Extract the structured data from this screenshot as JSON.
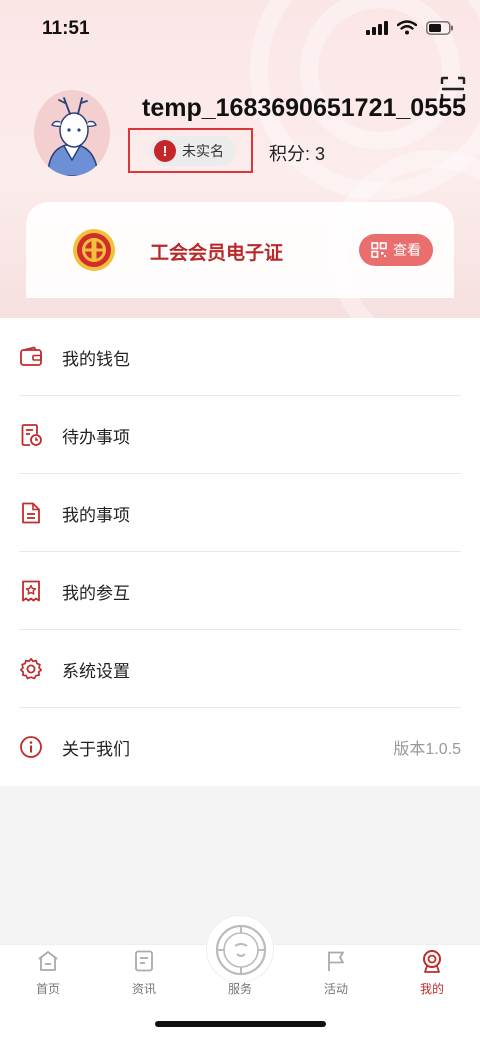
{
  "status_bar": {
    "time": "11:51"
  },
  "profile": {
    "username": "temp_1683690651721_0555",
    "verify_status": "未实名",
    "points_label": "积分: 3"
  },
  "member_card": {
    "title": "工会会员电子证",
    "view_label": "查看"
  },
  "menu": {
    "items": [
      {
        "label": "我的钱包",
        "icon": "wallet-icon"
      },
      {
        "label": "待办事项",
        "icon": "todo-icon"
      },
      {
        "label": "我的事项",
        "icon": "document-icon"
      },
      {
        "label": "我的参互",
        "icon": "star-doc-icon"
      },
      {
        "label": "系统设置",
        "icon": "gear-icon"
      },
      {
        "label": "关于我们",
        "icon": "info-icon",
        "right": "版本1.0.5"
      }
    ]
  },
  "tabbar": {
    "tabs": [
      {
        "label": "首页",
        "icon": "home-icon"
      },
      {
        "label": "资讯",
        "icon": "news-icon"
      },
      {
        "label": "服务",
        "icon": "service-icon"
      },
      {
        "label": "活动",
        "icon": "flag-icon"
      },
      {
        "label": "我的",
        "icon": "profile-badge-icon",
        "active": true
      }
    ]
  },
  "colors": {
    "accent": "#c22b2b",
    "accent_light": "#e96f6f",
    "header_bg": "#fbe6e6"
  }
}
